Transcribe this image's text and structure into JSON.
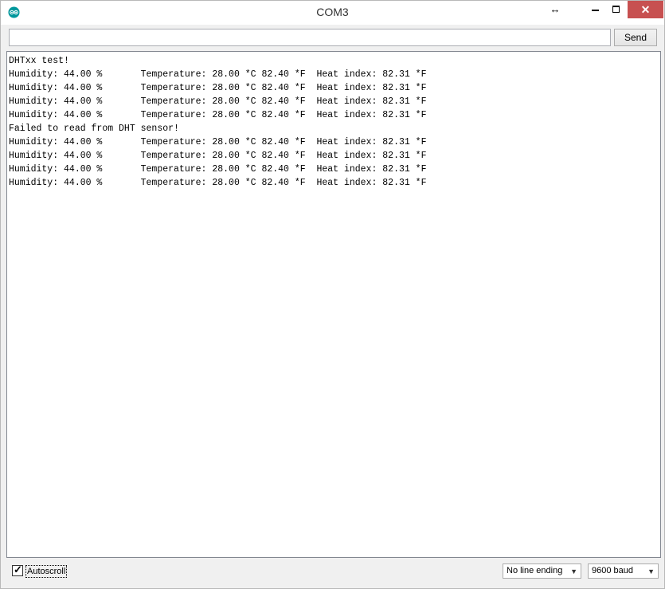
{
  "window": {
    "title": "COM3",
    "resize_glyph": "↔",
    "close_glyph": "✕",
    "icons": [
      "arduino-logo-icon",
      "resize-arrows-icon",
      "minimize-icon",
      "maximize-icon",
      "close-icon"
    ],
    "close_color": "#c75050"
  },
  "send_bar": {
    "input_value": "",
    "send_label": "Send"
  },
  "serial_output": {
    "lines": [
      "DHTxx test!",
      "Humidity: 44.00 %\tTemperature: 28.00 *C 82.40 *F\tHeat index: 82.31 *F",
      "Humidity: 44.00 %\tTemperature: 28.00 *C 82.40 *F\tHeat index: 82.31 *F",
      "Humidity: 44.00 %\tTemperature: 28.00 *C 82.40 *F\tHeat index: 82.31 *F",
      "Humidity: 44.00 %\tTemperature: 28.00 *C 82.40 *F\tHeat index: 82.31 *F",
      "Failed to read from DHT sensor!",
      "Humidity: 44.00 %\tTemperature: 28.00 *C 82.40 *F\tHeat index: 82.31 *F",
      "Humidity: 44.00 %\tTemperature: 28.00 *C 82.40 *F\tHeat index: 82.31 *F",
      "Humidity: 44.00 %\tTemperature: 28.00 *C 82.40 *F\tHeat index: 82.31 *F",
      "Humidity: 44.00 %\tTemperature: 28.00 *C 82.40 *F\tHeat index: 82.31 *F"
    ]
  },
  "status_bar": {
    "autoscroll_label": "Autoscroll",
    "autoscroll_checked": true,
    "line_ending_selected": "No line ending",
    "baud_selected": "9600 baud"
  }
}
